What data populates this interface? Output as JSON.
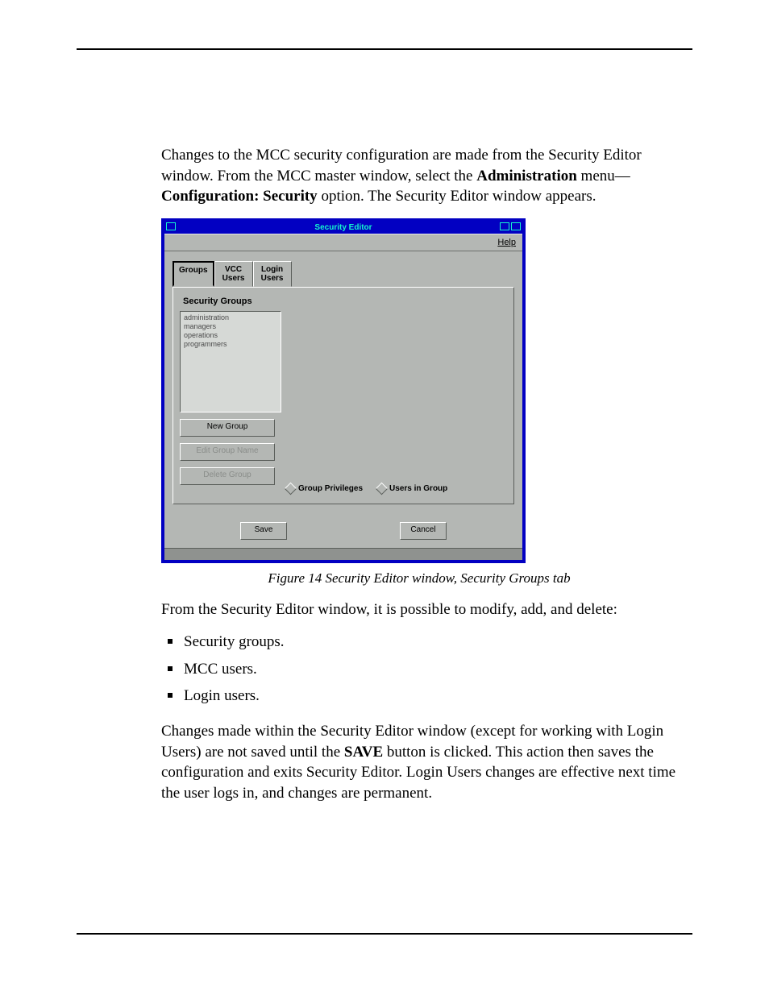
{
  "para1_pre": "Changes to the MCC security configuration are made from the Security Editor window. From the MCC master window, select the ",
  "para1_b1": "Administration",
  "para1_mid": " menu—",
  "para1_b2": "Configuration: Security",
  "para1_post": " option. The Security Editor window appears.",
  "window": {
    "title": "Security Editor",
    "help": "Help",
    "tabs": {
      "groups": "Groups",
      "vcc": "VCC\nUsers",
      "login": "Login\nUsers"
    },
    "panel_label": "Security Groups",
    "groups": [
      "administration",
      "managers",
      "operations",
      "programmers"
    ],
    "buttons": {
      "new": "New Group",
      "edit": "Edit Group Name",
      "delete": "Delete Group"
    },
    "radios": {
      "priv": "Group Privileges",
      "users": "Users in Group"
    },
    "save": "Save",
    "cancel": "Cancel"
  },
  "caption": "Figure 14 Security Editor window, Security Groups tab",
  "para2": "From the Security Editor window, it is possible to modify, add, and delete:",
  "bullets": [
    "Security groups.",
    "MCC users.",
    "Login users."
  ],
  "para3_pre": "Changes made within the Security Editor window (except for working with Login Users) are not saved until the ",
  "para3_b": "SAVE",
  "para3_post": " button is clicked. This action then saves the configuration and exits Security Editor. Login Users changes are effective next time the user logs in, and changes are permanent."
}
